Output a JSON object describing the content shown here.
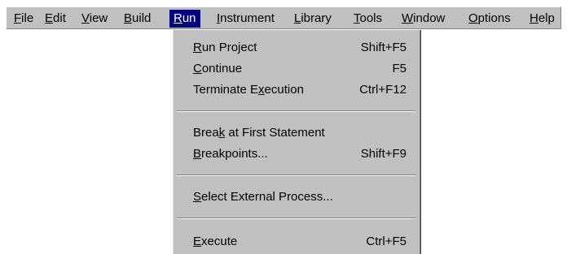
{
  "menubar": {
    "items": [
      {
        "pre": "",
        "mn": "F",
        "post": "ile"
      },
      {
        "pre": "",
        "mn": "E",
        "post": "dit"
      },
      {
        "pre": "",
        "mn": "V",
        "post": "iew"
      },
      {
        "pre": "",
        "mn": "B",
        "post": "uild"
      },
      {
        "pre": "",
        "mn": "R",
        "post": "un"
      },
      {
        "pre": "",
        "mn": "I",
        "post": "nstrument"
      },
      {
        "pre": "",
        "mn": "L",
        "post": "ibrary"
      },
      {
        "pre": "",
        "mn": "T",
        "post": "ools"
      },
      {
        "pre": "",
        "mn": "W",
        "post": "indow"
      },
      {
        "pre": "",
        "mn": "O",
        "post": "ptions"
      },
      {
        "pre": "",
        "mn": "H",
        "post": "elp"
      }
    ]
  },
  "run_menu": {
    "items": [
      {
        "pre": "",
        "mn": "R",
        "post": "un Project",
        "accel": "Shift+F5"
      },
      {
        "pre": "",
        "mn": "C",
        "post": "ontinue",
        "accel": "F5"
      },
      {
        "pre": "Terminate E",
        "mn": "x",
        "post": "ecution",
        "accel": "Ctrl+F12"
      },
      {
        "pre": "Brea",
        "mn": "k",
        "post": " at First Statement",
        "accel": ""
      },
      {
        "pre": "",
        "mn": "B",
        "post": "reakpoints...",
        "accel": "Shift+F9"
      },
      {
        "pre": "",
        "mn": "S",
        "post": "elect External Process...",
        "accel": ""
      },
      {
        "pre": "",
        "mn": "E",
        "post": "xecute",
        "accel": "Ctrl+F5"
      }
    ]
  },
  "colors": {
    "menu_bg": "#c0c0c0",
    "highlight_bg": "#000080",
    "highlight_text": "#ffffff"
  }
}
